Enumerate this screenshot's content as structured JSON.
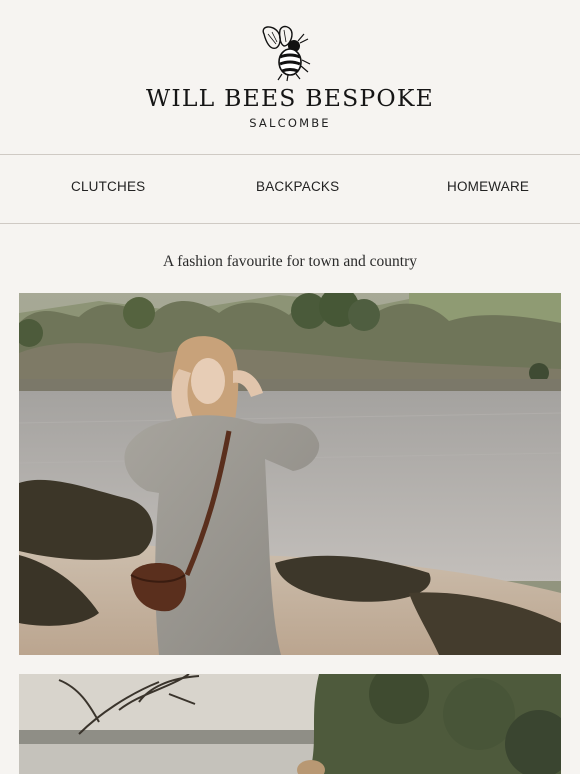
{
  "brand": {
    "name": "WILL BEES BESPOKE",
    "location": "SALCOMBE",
    "logo_icon": "bee-icon"
  },
  "nav": {
    "items": [
      {
        "label": "CLUTCHES"
      },
      {
        "label": "BACKPACKS"
      },
      {
        "label": "HOMEWARE"
      }
    ]
  },
  "hero": {
    "tagline": "A fashion favourite for town and country"
  },
  "colors": {
    "background": "#f6f4f1",
    "divider": "#cfcac4",
    "text": "#222222"
  }
}
